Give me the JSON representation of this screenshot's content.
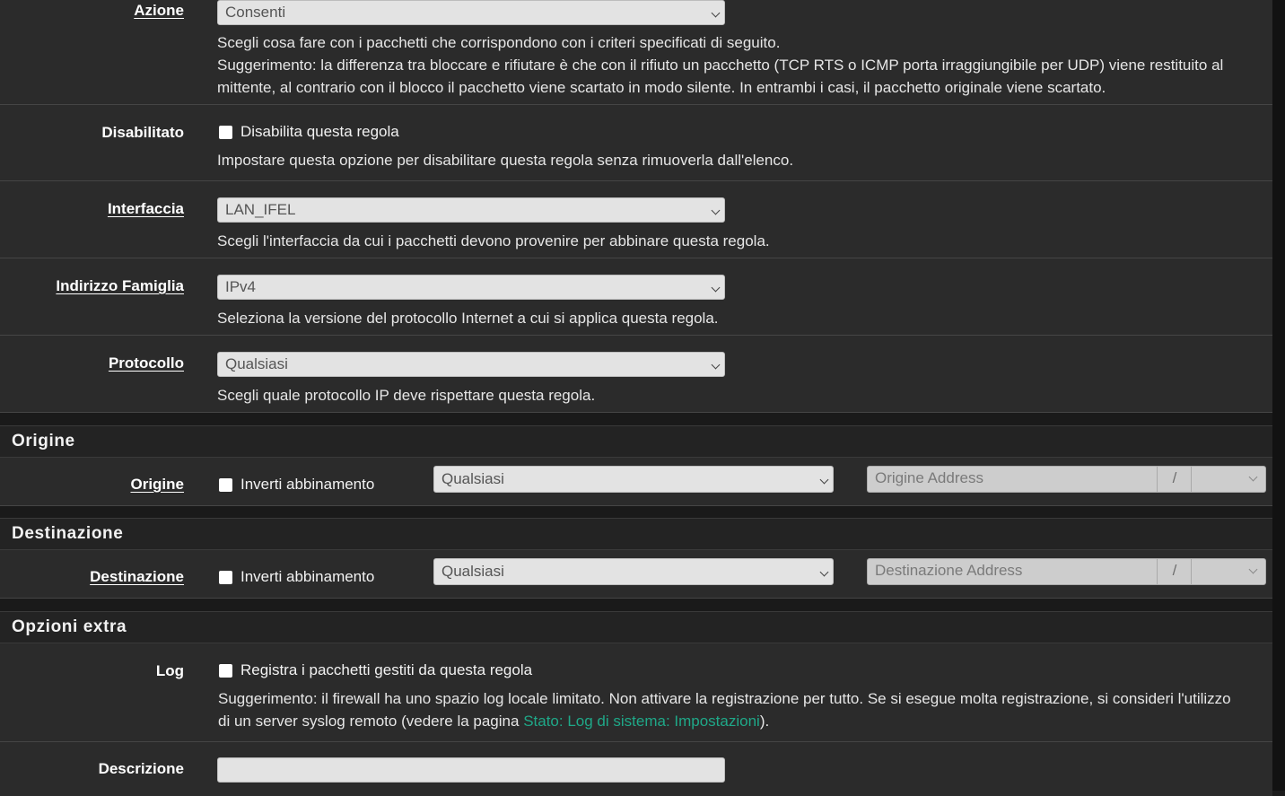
{
  "azione": {
    "label": "Azione",
    "value": "Consenti",
    "help1": "Scegli cosa fare con i pacchetti che corrispondono con i criteri specificati di seguito.",
    "help2": "Suggerimento: la differenza tra bloccare e rifiutare è che con il rifiuto un pacchetto (TCP RTS o ICMP porta irraggiungibile per UDP) viene restituito al",
    "help3": "mittente, al contrario con il blocco il pacchetto viene scartato in modo silente. In entrambi i casi, il pacchetto originale viene scartato."
  },
  "disabilitato": {
    "label": "Disabilitato",
    "checkbox": "Disabilita questa regola",
    "help": "Impostare questa opzione per disabilitare questa regola senza rimuoverla dall'elenco."
  },
  "interfaccia": {
    "label": "Interfaccia",
    "value": "LAN_IFEL",
    "help": "Scegli l'interfaccia da cui i pacchetti devono provenire per abbinare questa regola."
  },
  "famiglia": {
    "label": "Indirizzo Famiglia",
    "value": "IPv4",
    "help": "Seleziona la versione del protocollo Internet a cui si applica questa regola."
  },
  "protocollo": {
    "label": "Protocollo",
    "value": "Qualsiasi",
    "help": "Scegli quale protocollo IP deve rispettare questa regola."
  },
  "origine": {
    "section": "Origine",
    "label": "Origine",
    "invert": "Inverti abbinamento",
    "type": "Qualsiasi",
    "address_placeholder": "Origine Address",
    "slash": "/"
  },
  "destinazione": {
    "section": "Destinazione",
    "label": "Destinazione",
    "invert": "Inverti abbinamento",
    "type": "Qualsiasi",
    "address_placeholder": "Destinazione Address",
    "slash": "/"
  },
  "extra": {
    "section": "Opzioni extra",
    "log_label": "Log",
    "log_checkbox": "Registra i pacchetti gestiti da questa regola",
    "log_help1": "Suggerimento: il firewall ha uno spazio log locale limitato. Non attivare la registrazione per tutto. Se si esegue molta registrazione, si consideri l'utilizzo",
    "log_help2_pre": "di un server syslog remoto (vedere la pagina ",
    "log_help2_link": "Stato: Log di sistema: Impostazioni",
    "log_help2_post": ").",
    "descr_label": "Descrizione",
    "descr_value": ""
  },
  "colors": {
    "panel": "#2b2b2b",
    "link": "#1fa888",
    "header": "#232323"
  }
}
